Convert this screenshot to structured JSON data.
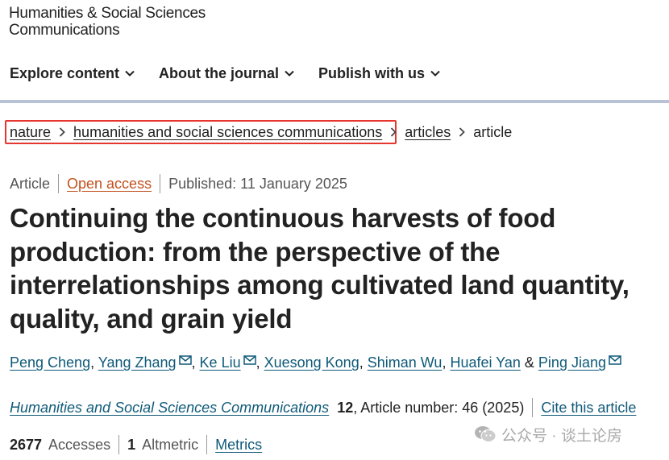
{
  "logo": {
    "line1": "Humanities & Social Sciences",
    "line2": "Communications"
  },
  "nav": {
    "items": [
      {
        "label": "Explore content"
      },
      {
        "label": "About the journal"
      },
      {
        "label": "Publish with us"
      }
    ]
  },
  "breadcrumb": {
    "items": [
      "nature",
      "humanities and social sciences communications",
      "articles",
      "article"
    ]
  },
  "meta": {
    "type": "Article",
    "access": "Open access",
    "published": "Published: 11 January 2025"
  },
  "article": {
    "title": "Continuing the continuous harvests of food production: from the perspective of the interrelationships among cultivated land quantity, quality, and grain yield"
  },
  "authors": {
    "names": [
      "Peng Cheng",
      "Yang Zhang",
      "Ke Liu",
      "Xuesong Kong",
      "Shiman Wu",
      "Huafei Yan",
      "Ping Jiang"
    ],
    "and": "&"
  },
  "citation": {
    "journal": "Humanities and Social Sciences Communications",
    "volume": "12",
    "article_info": ", Article number: 46 (2025)",
    "cite_label": "Cite this article"
  },
  "metrics": {
    "accesses_count": "2677",
    "accesses_label": "Accesses",
    "altmetric_count": "1",
    "altmetric_label": "Altmetric",
    "metrics_label": "Metrics"
  },
  "watermark": {
    "text": "公众号 · 谈土论房"
  },
  "colors": {
    "link": "#0f5a7a",
    "open_access": "#c2511f",
    "highlight": "#e5362f",
    "rule": "#b9c1d6"
  }
}
